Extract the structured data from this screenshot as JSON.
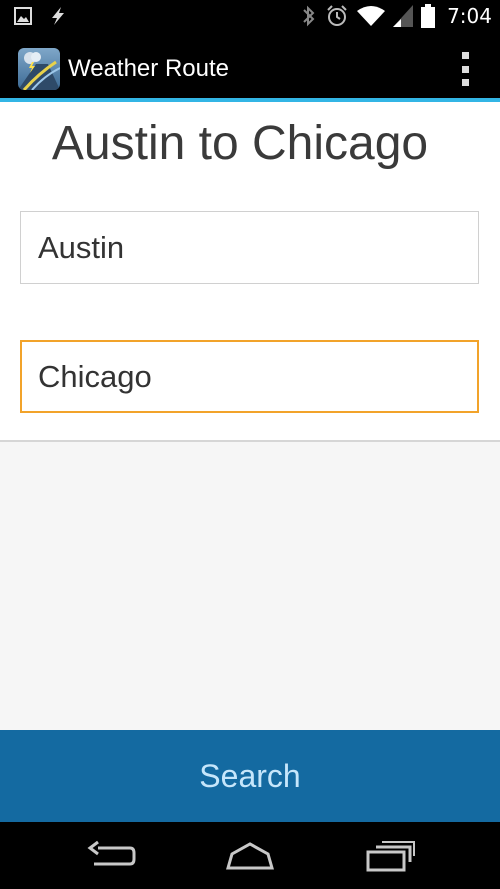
{
  "status_bar": {
    "time": "7:04",
    "left_icons": [
      "image-icon",
      "flash-icon"
    ],
    "right_icons": [
      "bluetooth-icon",
      "alarm-icon",
      "wifi-icon",
      "cell-signal-icon",
      "battery-icon"
    ]
  },
  "action_bar": {
    "app_title": "Weather Route",
    "accent_color": "#33b5e5"
  },
  "form": {
    "route_title": "Austin to Chicago",
    "from_value": "Austin",
    "to_value": "Chicago",
    "focus_color": "#f2a32a"
  },
  "search_button": {
    "label": "Search",
    "color": "#146aa1"
  },
  "nav_bar": {
    "buttons": [
      "back-icon",
      "home-icon",
      "recent-apps-icon"
    ]
  }
}
